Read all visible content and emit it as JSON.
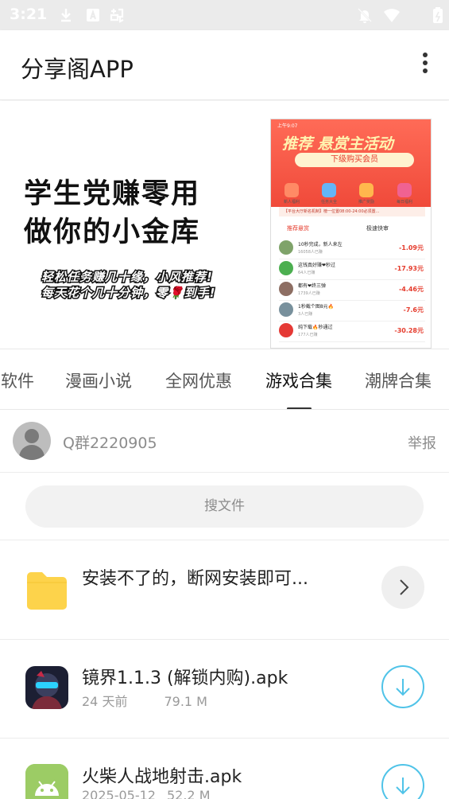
{
  "status_bar": {
    "time": "3:21",
    "icons": [
      "download-icon",
      "a-box-icon",
      "ghost-icon",
      "bell-off-icon",
      "wifi-icon",
      "battery-icon"
    ]
  },
  "app_bar": {
    "title": "分享阁APP",
    "menu_icon": "more-vertical-icon"
  },
  "banner": {
    "headline_1": "学生党赚零用",
    "headline_2": "做你的小金库",
    "subline_1": "轻松任务赚几十缘，小风推荐!",
    "subline_2": "每天花个几十分钟，零🌹到手!",
    "phone": {
      "time": "上午9:07",
      "promo": "推荐 悬赏主活动",
      "vip": "下级购买会员",
      "categories": [
        "新人福利",
        "任务大全",
        "推广奖励",
        "每日福利"
      ],
      "notice": "【平台大厅新名机制】榜一位置08:00-24:00必须置...",
      "tab_1": "推荐悬赏",
      "tab_2": "极速快审",
      "rows": [
        {
          "title": "10秒完成，新人来左",
          "sub": "16058人已赚",
          "price": "-1.09元"
        },
        {
          "title": "这钱真好赚❤秒过",
          "sub": "64人已赚",
          "price": "-17.93元"
        },
        {
          "title": "都有❤终三弹",
          "sub": "1739人已赚",
          "price": "-4.46元"
        },
        {
          "title": "1秒截个图8元🔥",
          "sub": "3人已赚",
          "price": "-7.6元"
        },
        {
          "title": "纯下载🔥秒通过",
          "sub": "177人已赚",
          "price": "-30.28元"
        }
      ]
    }
  },
  "tabs": {
    "items": [
      "软件",
      "漫画小说",
      "全网优惠",
      "游戏合集",
      "潮牌合集"
    ],
    "active": "游戏合集"
  },
  "user": {
    "name": "Q群2220905",
    "report_label": "举报"
  },
  "search": {
    "placeholder": "搜文件"
  },
  "files": {
    "folder": {
      "title": "安装不了的，断网安装即可...",
      "icon": "folder-icon",
      "action_icon": "chevron-right-icon"
    },
    "apks": [
      {
        "title": "镜界1.1.3 (解锁内购).apk",
        "date": "24 天前",
        "size": "79.1 M",
        "icon": "game-character-icon",
        "action_icon": "download-icon"
      },
      {
        "title": "火柴人战地射击.apk",
        "date": "2025-05-12",
        "size": "52.2 M",
        "icon": "android-icon",
        "action_icon": "download-icon"
      }
    ]
  },
  "colors": {
    "status_bar_bg": "#ebebeb",
    "download_ring": "#4fc3e8",
    "folder_yellow": "#fdd34b",
    "android_green": "#9ccc65"
  }
}
